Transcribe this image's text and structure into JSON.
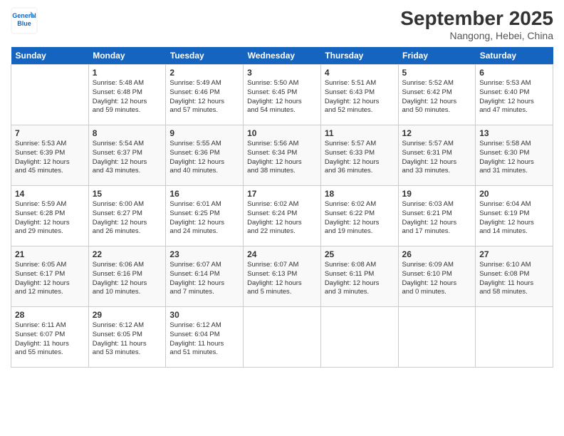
{
  "logo": {
    "line1": "General",
    "line2": "Blue"
  },
  "title": "September 2025",
  "location": "Nangong, Hebei, China",
  "weekdays": [
    "Sunday",
    "Monday",
    "Tuesday",
    "Wednesday",
    "Thursday",
    "Friday",
    "Saturday"
  ],
  "weeks": [
    [
      {
        "num": "",
        "info": ""
      },
      {
        "num": "1",
        "info": "Sunrise: 5:48 AM\nSunset: 6:48 PM\nDaylight: 12 hours\nand 59 minutes."
      },
      {
        "num": "2",
        "info": "Sunrise: 5:49 AM\nSunset: 6:46 PM\nDaylight: 12 hours\nand 57 minutes."
      },
      {
        "num": "3",
        "info": "Sunrise: 5:50 AM\nSunset: 6:45 PM\nDaylight: 12 hours\nand 54 minutes."
      },
      {
        "num": "4",
        "info": "Sunrise: 5:51 AM\nSunset: 6:43 PM\nDaylight: 12 hours\nand 52 minutes."
      },
      {
        "num": "5",
        "info": "Sunrise: 5:52 AM\nSunset: 6:42 PM\nDaylight: 12 hours\nand 50 minutes."
      },
      {
        "num": "6",
        "info": "Sunrise: 5:53 AM\nSunset: 6:40 PM\nDaylight: 12 hours\nand 47 minutes."
      }
    ],
    [
      {
        "num": "7",
        "info": "Sunrise: 5:53 AM\nSunset: 6:39 PM\nDaylight: 12 hours\nand 45 minutes."
      },
      {
        "num": "8",
        "info": "Sunrise: 5:54 AM\nSunset: 6:37 PM\nDaylight: 12 hours\nand 43 minutes."
      },
      {
        "num": "9",
        "info": "Sunrise: 5:55 AM\nSunset: 6:36 PM\nDaylight: 12 hours\nand 40 minutes."
      },
      {
        "num": "10",
        "info": "Sunrise: 5:56 AM\nSunset: 6:34 PM\nDaylight: 12 hours\nand 38 minutes."
      },
      {
        "num": "11",
        "info": "Sunrise: 5:57 AM\nSunset: 6:33 PM\nDaylight: 12 hours\nand 36 minutes."
      },
      {
        "num": "12",
        "info": "Sunrise: 5:57 AM\nSunset: 6:31 PM\nDaylight: 12 hours\nand 33 minutes."
      },
      {
        "num": "13",
        "info": "Sunrise: 5:58 AM\nSunset: 6:30 PM\nDaylight: 12 hours\nand 31 minutes."
      }
    ],
    [
      {
        "num": "14",
        "info": "Sunrise: 5:59 AM\nSunset: 6:28 PM\nDaylight: 12 hours\nand 29 minutes."
      },
      {
        "num": "15",
        "info": "Sunrise: 6:00 AM\nSunset: 6:27 PM\nDaylight: 12 hours\nand 26 minutes."
      },
      {
        "num": "16",
        "info": "Sunrise: 6:01 AM\nSunset: 6:25 PM\nDaylight: 12 hours\nand 24 minutes."
      },
      {
        "num": "17",
        "info": "Sunrise: 6:02 AM\nSunset: 6:24 PM\nDaylight: 12 hours\nand 22 minutes."
      },
      {
        "num": "18",
        "info": "Sunrise: 6:02 AM\nSunset: 6:22 PM\nDaylight: 12 hours\nand 19 minutes."
      },
      {
        "num": "19",
        "info": "Sunrise: 6:03 AM\nSunset: 6:21 PM\nDaylight: 12 hours\nand 17 minutes."
      },
      {
        "num": "20",
        "info": "Sunrise: 6:04 AM\nSunset: 6:19 PM\nDaylight: 12 hours\nand 14 minutes."
      }
    ],
    [
      {
        "num": "21",
        "info": "Sunrise: 6:05 AM\nSunset: 6:17 PM\nDaylight: 12 hours\nand 12 minutes."
      },
      {
        "num": "22",
        "info": "Sunrise: 6:06 AM\nSunset: 6:16 PM\nDaylight: 12 hours\nand 10 minutes."
      },
      {
        "num": "23",
        "info": "Sunrise: 6:07 AM\nSunset: 6:14 PM\nDaylight: 12 hours\nand 7 minutes."
      },
      {
        "num": "24",
        "info": "Sunrise: 6:07 AM\nSunset: 6:13 PM\nDaylight: 12 hours\nand 5 minutes."
      },
      {
        "num": "25",
        "info": "Sunrise: 6:08 AM\nSunset: 6:11 PM\nDaylight: 12 hours\nand 3 minutes."
      },
      {
        "num": "26",
        "info": "Sunrise: 6:09 AM\nSunset: 6:10 PM\nDaylight: 12 hours\nand 0 minutes."
      },
      {
        "num": "27",
        "info": "Sunrise: 6:10 AM\nSunset: 6:08 PM\nDaylight: 11 hours\nand 58 minutes."
      }
    ],
    [
      {
        "num": "28",
        "info": "Sunrise: 6:11 AM\nSunset: 6:07 PM\nDaylight: 11 hours\nand 55 minutes."
      },
      {
        "num": "29",
        "info": "Sunrise: 6:12 AM\nSunset: 6:05 PM\nDaylight: 11 hours\nand 53 minutes."
      },
      {
        "num": "30",
        "info": "Sunrise: 6:12 AM\nSunset: 6:04 PM\nDaylight: 11 hours\nand 51 minutes."
      },
      {
        "num": "",
        "info": ""
      },
      {
        "num": "",
        "info": ""
      },
      {
        "num": "",
        "info": ""
      },
      {
        "num": "",
        "info": ""
      }
    ]
  ]
}
